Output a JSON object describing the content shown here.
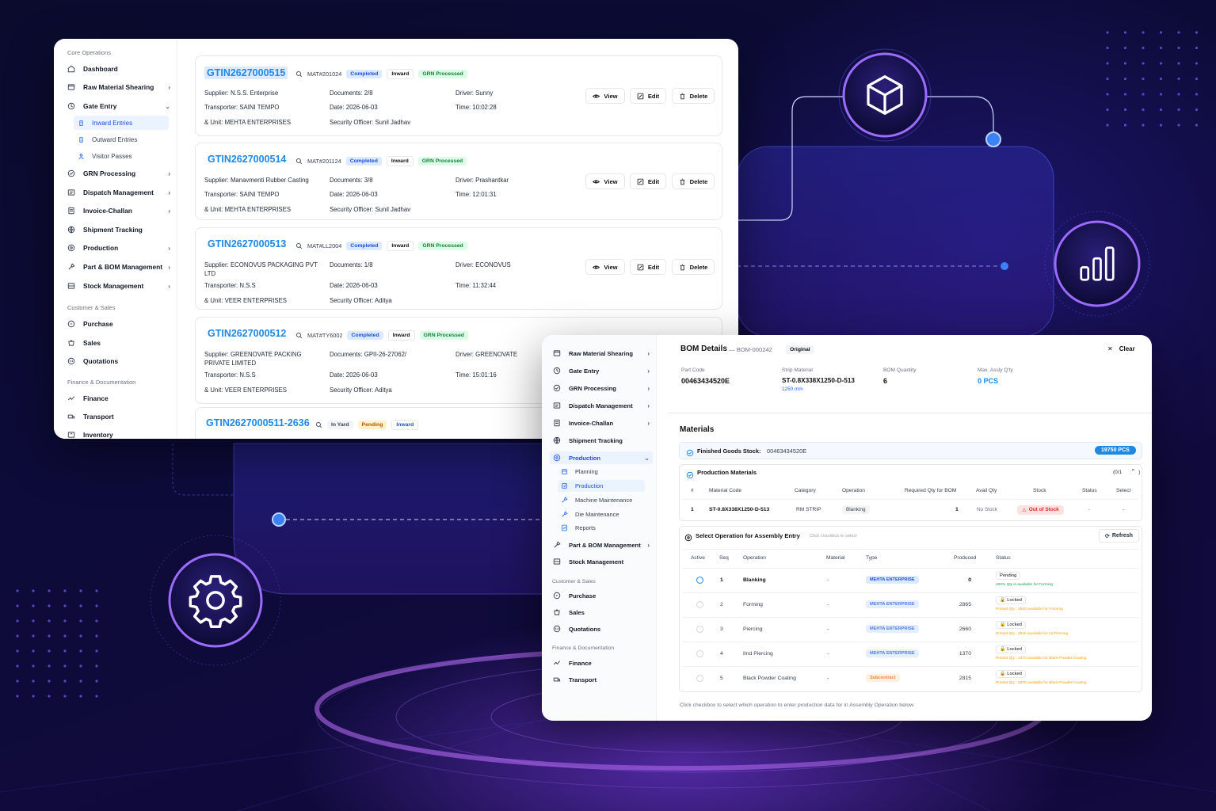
{
  "back": {
    "sidebar": {
      "section_core": "Core Operations",
      "items": [
        {
          "label": "Dashboard",
          "icon": "home-icon",
          "chev": ""
        },
        {
          "label": "Raw Material Shearing",
          "icon": "box-icon",
          "chev": "›"
        },
        {
          "label": "Gate Entry",
          "icon": "gate-icon",
          "chev": "⌄"
        },
        {
          "label": "GRN Processing",
          "icon": "grn-icon",
          "chev": "›"
        },
        {
          "label": "Dispatch Management",
          "icon": "dispatch-icon",
          "chev": "›"
        },
        {
          "label": "Invoice-Challan",
          "icon": "invoice-icon",
          "chev": "›"
        },
        {
          "label": "Shipment Tracking",
          "icon": "shipment-icon",
          "chev": ""
        },
        {
          "label": "Production",
          "icon": "production-icon",
          "chev": "›"
        },
        {
          "label": "Part & BOM Management",
          "icon": "tool-icon",
          "chev": "›"
        },
        {
          "label": "Stock Management",
          "icon": "stock-icon",
          "chev": "›"
        }
      ],
      "subitems": [
        {
          "label": "Inward Entries",
          "icon": "inward-icon"
        },
        {
          "label": "Outward Entries",
          "icon": "outward-icon"
        },
        {
          "label": "Visitor Passes",
          "icon": "visitor-icon"
        }
      ],
      "section_sales": "Customer & Sales",
      "sales": [
        {
          "label": "Purchase",
          "icon": "purchase-icon"
        },
        {
          "label": "Sales",
          "icon": "sales-icon"
        },
        {
          "label": "Quotations",
          "icon": "quotation-icon"
        }
      ],
      "section_finance": "Finance & Documentation",
      "finance": [
        {
          "label": "Finance",
          "icon": "finance-icon"
        },
        {
          "label": "Transport",
          "icon": "transport-icon"
        },
        {
          "label": "Inventory",
          "icon": "inventory-icon"
        }
      ]
    },
    "entries": [
      {
        "gtin": "GTIN2627000515",
        "mat": "MAT#201024",
        "badges": [
          "Completed",
          "Inward",
          "GRN Processed"
        ],
        "supplier": "Supplier: N.S.S. Enterprise",
        "supplier2": "",
        "transporter": "Transporter: SAINI TEMPO",
        "unit": "& Unit: MEHTA ENTERPRISES",
        "documents": "Documents: 2/8",
        "date": "Date: 2026-06-03",
        "officer": "Security Officer: Sunil Jadhav",
        "driver": "Driver: Sunny",
        "time": "Time: 10:02:28"
      },
      {
        "gtin": "GTIN2627000514",
        "mat": "MAT#201124",
        "badges": [
          "Completed",
          "Inward",
          "GRN Processed"
        ],
        "supplier": "Supplier: Manavmenti Rubber Casting",
        "supplier2": "",
        "transporter": "Transporter: SAINI TEMPO",
        "unit": "& Unit: MEHTA ENTERPRISES",
        "documents": "Documents: 3/8",
        "date": "Date: 2026-06-03",
        "officer": "Security Officer: Sunil Jadhav",
        "driver": "Driver: Prashantkar",
        "time": "Time: 12:01:31"
      },
      {
        "gtin": "GTIN2627000513",
        "mat": "MAT#LL2004",
        "badges": [
          "Completed",
          "Inward",
          "GRN Processed"
        ],
        "supplier": "Supplier: ECONOVUS PACKAGING PVT",
        "supplier2": "LTD",
        "transporter": "Transporter: N.S.S",
        "unit": "& Unit: VEER ENTERPRISES",
        "documents": "Documents: 1/8",
        "date": "Date: 2026-06-03",
        "officer": "Security Officer: Aditya",
        "driver": "Driver: ECONOVUS",
        "time": "Time: 11:32:44"
      },
      {
        "gtin": "GTIN2627000512",
        "mat": "MAT#TY6002",
        "badges": [
          "Completed",
          "Inward",
          "GRN Processed"
        ],
        "supplier": "Supplier: GREENOVATE PACKING",
        "supplier2": "PRIVATE LIMITED",
        "transporter": "Transporter: N.S.S",
        "unit": "& Unit: VEER ENTERPRISES",
        "documents": "Documents: GPII-26-27062/",
        "date": "Date: 2026-06-03",
        "officer": "Security Officer: Aditya",
        "driver": "Driver: GREENOVATE",
        "time": "Time: 15:01:16"
      }
    ],
    "entry5": {
      "gtin": "GTIN2627000511-2636",
      "badges": [
        "In Yard",
        "Pending",
        "Inward"
      ]
    },
    "buttons": {
      "view": "View",
      "edit": "Edit",
      "delete": "Delete"
    }
  },
  "front": {
    "sidebar": {
      "items": [
        {
          "label": "Raw Material Shearing",
          "icon": "box-icon",
          "chev": "›"
        },
        {
          "label": "Gate Entry",
          "icon": "gate-icon",
          "chev": "›"
        },
        {
          "label": "GRN Processing",
          "icon": "grn-icon",
          "chev": "›"
        },
        {
          "label": "Dispatch Management",
          "icon": "dispatch-icon",
          "chev": "›"
        },
        {
          "label": "Invoice-Challan",
          "icon": "invoice-icon",
          "chev": "›"
        },
        {
          "label": "Shipment Tracking",
          "icon": "shipment-icon",
          "chev": ""
        },
        {
          "label": "Production",
          "icon": "production-icon",
          "chev": "⌄"
        }
      ],
      "subitems": [
        {
          "label": "Planning",
          "icon": "planning-icon"
        },
        {
          "label": "Production",
          "icon": "production-sub-icon"
        },
        {
          "label": "Machine Maintenance",
          "icon": "wrench-icon"
        },
        {
          "label": "Die Maintenance",
          "icon": "wrench-icon"
        },
        {
          "label": "Reports",
          "icon": "report-icon"
        }
      ],
      "items2": [
        {
          "label": "Part & BOM Management",
          "icon": "tool-icon",
          "chev": "›"
        },
        {
          "label": "Stock Management",
          "icon": "stock-icon",
          "chev": ""
        }
      ],
      "section_sales": "Customer & Sales",
      "sales": [
        {
          "label": "Purchase",
          "icon": "purchase-icon"
        },
        {
          "label": "Sales",
          "icon": "sales-icon"
        },
        {
          "label": "Quotations",
          "icon": "quotation-icon"
        }
      ],
      "section_finance": "Finance & Documentation",
      "finance": [
        {
          "label": "Finance",
          "icon": "finance-icon"
        },
        {
          "label": "Transport",
          "icon": "transport-icon"
        }
      ]
    },
    "bom": {
      "title": "BOM Details",
      "id": "— BOM-000242",
      "badge": "Original",
      "clear": "Clear",
      "part_code_label": "Part Code",
      "part_code": "00463434520E",
      "strip_label": "Strip Material",
      "strip": "ST-0.8X338X1250-D-513",
      "strip_sub": "1250 mm",
      "qty_label": "BOM Quantity",
      "qty": "6",
      "max_label": "Max. Assly Q'ty",
      "max": "0 PCS"
    },
    "materials": {
      "title": "Materials",
      "fg_label": "Finished Goods Stock:",
      "fg_code": "00463434520E",
      "fg_qty": "19750 PCS",
      "pm_title": "Production Materials",
      "pm_count": "0/1",
      "headers": [
        "#",
        "Material Code",
        "Category",
        "Operation",
        "Required Qty for BOM",
        "Avail Qty",
        "Stock",
        "Status",
        "Select"
      ],
      "row": [
        "1",
        "ST-0.8X338X1250-D-513",
        "RM STRIP",
        "Blanking",
        "1",
        "No Stock",
        "Out of Stock",
        "-",
        "-"
      ]
    },
    "ops": {
      "title": "Select Operation for Assembly Entry",
      "hint": "Click checkbox to select",
      "refresh": "Refresh",
      "headers": [
        "Active",
        "Seq",
        "Operation",
        "Material",
        "Type",
        "Produced",
        "Status"
      ],
      "rows": [
        {
          "seq": "1",
          "op": "Blanking",
          "mat": "-",
          "type": "MEHTA ENTERPRISE",
          "produced": "0",
          "status": "Pending",
          "note": "100% Qty is available for Forming"
        },
        {
          "seq": "2",
          "op": "Forming",
          "mat": "-",
          "type": "MEHTA ENTERPRISE",
          "produced": "2865",
          "status": "Locked",
          "note": "Printed Qty : 2840 available for Forming"
        },
        {
          "seq": "3",
          "op": "Piercing",
          "mat": "-",
          "type": "MEHTA ENTERPRISE",
          "produced": "2660",
          "status": "Locked",
          "note": "Printed Qty : 2840 available for nd Piercing"
        },
        {
          "seq": "4",
          "op": "IInd Piercing",
          "mat": "-",
          "type": "MEHTA ENTERPRISE",
          "produced": "1370",
          "status": "Locked",
          "note": "Printed Qty : 1370 available for Black Powder Coating"
        },
        {
          "seq": "5",
          "op": "Black Powder Coating",
          "mat": "-",
          "type": "Subcontract",
          "produced": "2815",
          "status": "Locked",
          "note": "Printed Qty : 2875 available for Black Powder Coating"
        }
      ],
      "footer": "Click checkbox to select which operation to enter production data for in Assembly Operation below."
    }
  },
  "colors": {
    "accent": "#1e88e5",
    "purple": "#8b5cf6",
    "red": "#dc2626",
    "green": "#16a34a"
  }
}
